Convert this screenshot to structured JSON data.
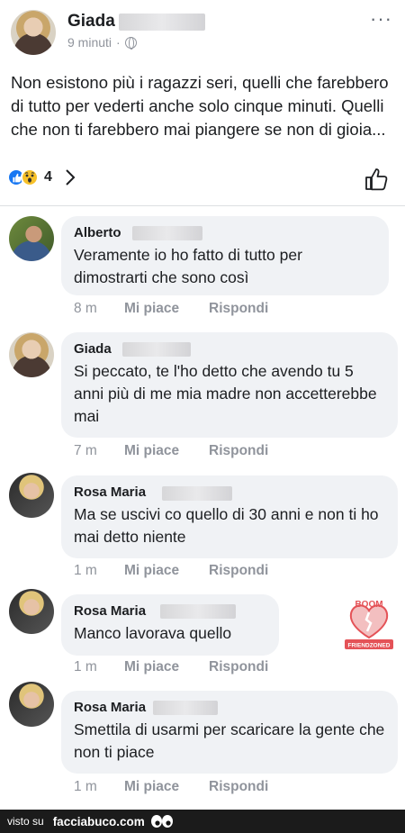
{
  "post": {
    "author": "Giada",
    "time": "9 minuti",
    "separator": "·",
    "text": "Non esistono più i ragazzi seri, quelli che farebbero di tutto per vederti anche solo cinque minuti. Quelli che non ti farebbero mai piangere se non di gioia...",
    "reaction_count": "4",
    "more_label": "···",
    "icons": [
      "globe-icon",
      "like-reaction-icon",
      "wow-reaction-icon",
      "chevron-right-icon",
      "thumbs-up-icon",
      "more-icon"
    ]
  },
  "comments": [
    {
      "author": "Alberto",
      "text": "Veramente io ho fatto di tutto per dimostrarti che sono così",
      "time": "8 m",
      "like_label": "Mi piace",
      "reply_label": "Rispondi"
    },
    {
      "author": "Giada",
      "text": "Si peccato, te l'ho detto che avendo tu 5 anni più di me mia madre non accetterebbe mai",
      "time": "7 m",
      "like_label": "Mi piace",
      "reply_label": "Rispondi"
    },
    {
      "author": "Rosa Maria",
      "text": "Ma se uscivi co quello di 30 anni e non ti ho mai detto niente",
      "time": "1 m",
      "like_label": "Mi piace",
      "reply_label": "Rispondi"
    },
    {
      "author": "Rosa Maria",
      "text": "Manco lavorava quello",
      "time": "1 m",
      "like_label": "Mi piace",
      "reply_label": "Rispondi"
    },
    {
      "author": "Rosa Maria",
      "text": "Smettila di usarmi per scaricare la gente che non ti piace",
      "time": "1 m",
      "like_label": "Mi piace",
      "reply_label": "Rispondi"
    }
  ],
  "watermark": {
    "top_text": "BOOM",
    "bottom_text": "FRIENDZONED"
  },
  "footer": {
    "visto_label": "visto su",
    "site": "facciabuco.com"
  },
  "colors": {
    "accent": "#1877f2",
    "bubble": "#f0f2f5",
    "meta": "#90949c",
    "footer": "#1b1b1b",
    "watermark": "#e0353a"
  }
}
